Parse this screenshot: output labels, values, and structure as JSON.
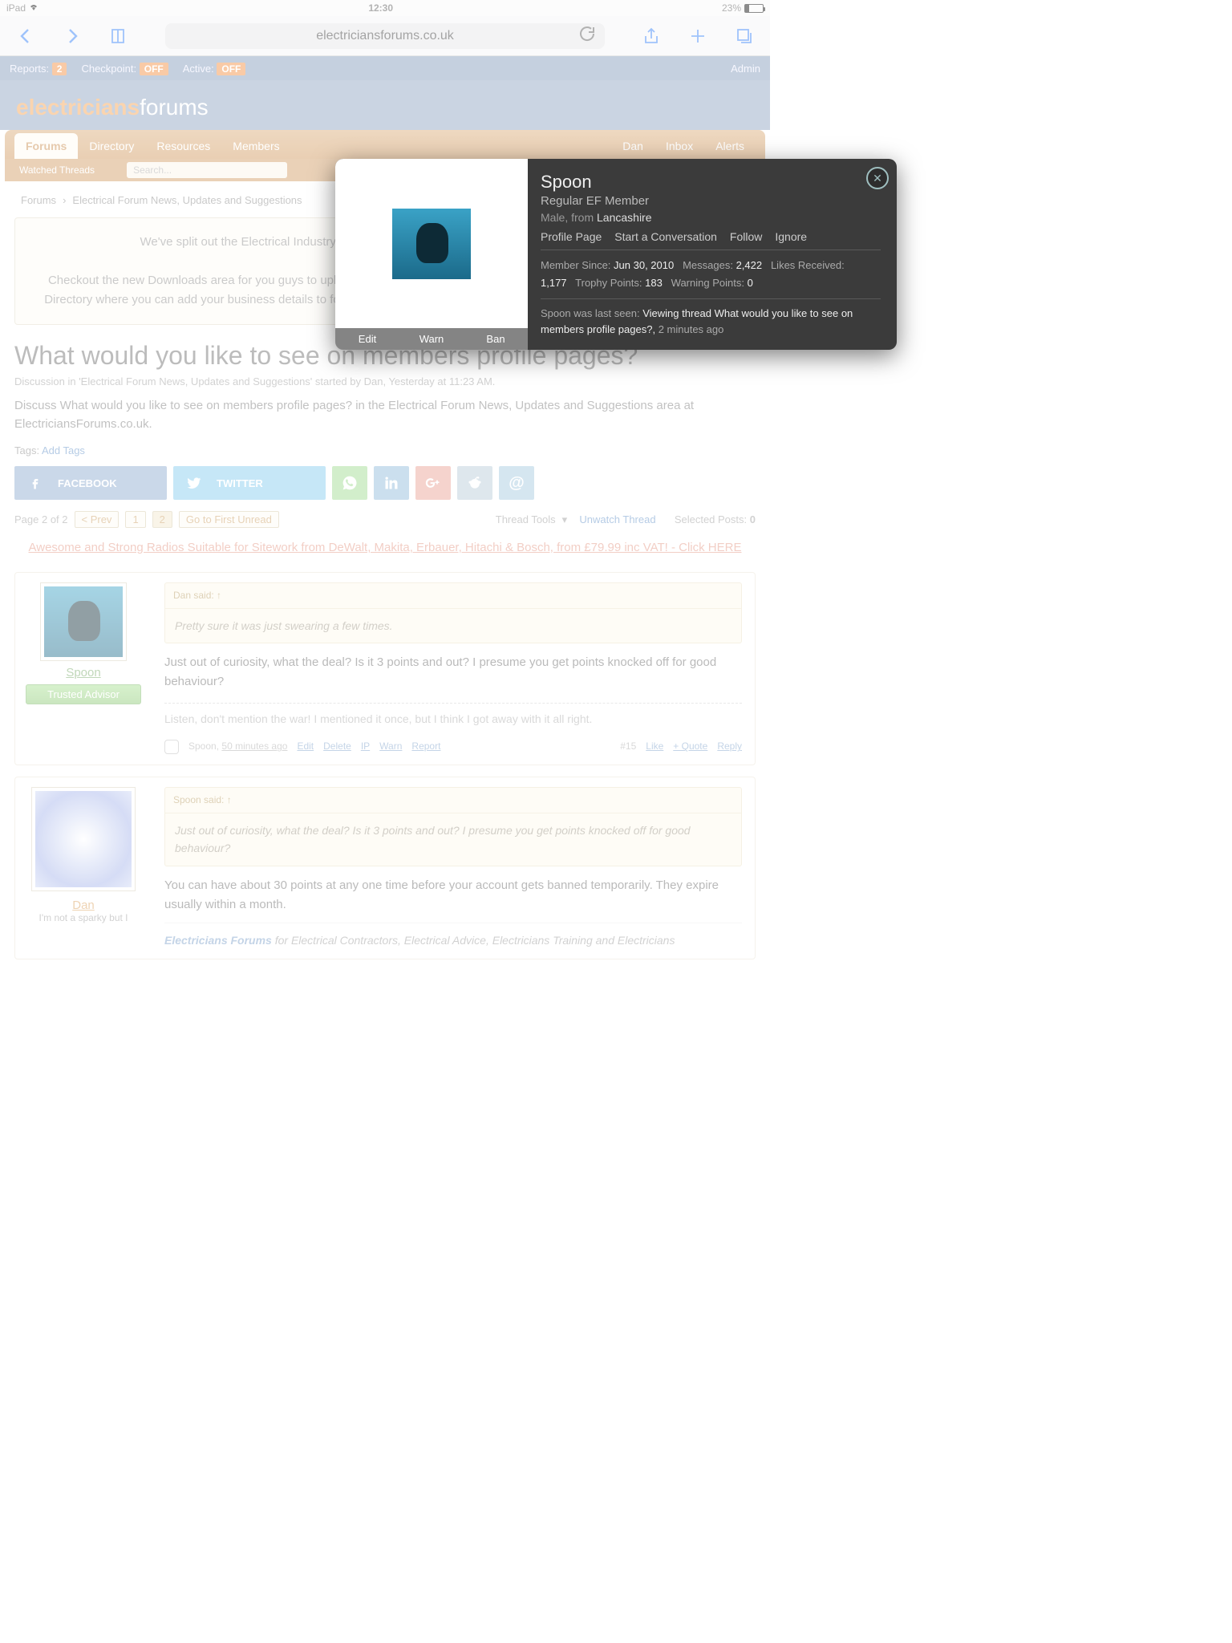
{
  "status": {
    "device": "iPad",
    "time": "12:30",
    "battery": "23%"
  },
  "browser": {
    "url": "electriciansforums.co.uk"
  },
  "adminbar": {
    "reports": "Reports:",
    "reports_n": "2",
    "checkpoint": "Checkpoint:",
    "cp_v": "OFF",
    "active": "Active:",
    "ac_v": "OFF",
    "admin": "Admin"
  },
  "logo": {
    "a": "electricians",
    "b": "forums"
  },
  "nav": {
    "forums": "Forums",
    "directory": "Directory",
    "resources": "Resources",
    "members": "Members",
    "user": "Dan",
    "inbox": "Inbox",
    "alerts": "Alerts"
  },
  "subnav": {
    "watched": "Watched Threads",
    "search_ph": "Search..."
  },
  "crumbs": {
    "a": "Forums",
    "b": "Electrical Forum News, Updates and Suggestions"
  },
  "notice": {
    "l1": "We've split out the Electrical Industry Electrician Talk from the main Electrical Forum. Please",
    "l2": "Checkout the new Downloads area for you guys to upload anything you have that'd be handy for others, and of course the new Directory where you can add your business details to for free. And of course, make sure you know where the Solar PV Forum is."
  },
  "thread": {
    "title": "What would you like to see on members profile pages?",
    "meta": "Discussion in 'Electrical Forum News, Updates and Suggestions' started by Dan, Yesterday at 11:23 AM.",
    "desc": "Discuss What would you like to see on members profile pages? in the Electrical Forum News, Updates and Suggestions area at ElectriciansForums.co.uk.",
    "tags_l": "Tags: ",
    "tags_a": "Add Tags"
  },
  "share": {
    "fb": "FACEBOOK",
    "tw": "TWITTER"
  },
  "pager": {
    "info": "Page 2 of 2",
    "prev": "< Prev",
    "p1": "1",
    "p2": "2",
    "first": "Go to First Unread",
    "tools": "Thread Tools",
    "unwatch": "Unwatch Thread",
    "sel": "Selected Posts:",
    "sel_n": "0"
  },
  "promo": "Awesome and Strong Radios Suitable for Sitework from DeWalt, Makita, Erbauer, Hitachi & Bosch, from £79.99 inc VAT! - Click HERE",
  "post1": {
    "user": "Spoon",
    "badge": "Trusted Advisor",
    "qh": "Dan said: ↑",
    "qb": "Pretty sure it was just swearing a few times.",
    "body": "Just out of curiosity, what the deal? Is it 3 points and out? I presume you get points knocked off for good behaviour?",
    "sig": "Listen, don't mention the war! I mentioned it once, but I think I got away with it all right.",
    "by": "Spoon,",
    "time": "50 minutes ago",
    "edit": "Edit",
    "del": "Delete",
    "ip": "IP",
    "warn": "Warn",
    "rep": "Report",
    "num": "#15",
    "like": "Like",
    "quote": "+ Quote",
    "reply": "Reply"
  },
  "post2": {
    "user": "Dan",
    "role": "I'm not a sparky but I",
    "qh": "Spoon said: ↑",
    "qb": "Just out of curiosity, what the deal? Is it 3 points and out? I presume you get points knocked off for good behaviour?",
    "body": "You can have about 30 points at any one time before your account gets banned temporarily. They expire usually within a month.",
    "foot_b": "Electricians Forums",
    "foot": " for Electrical Contractors, Electrical Advice, Electricians Training and Electricians"
  },
  "modal": {
    "name": "Spoon",
    "role": "Regular EF Member",
    "gender": "Male,",
    "from": " from ",
    "loc": "Lancashire",
    "links": {
      "profile": "Profile Page",
      "conv": "Start a Conversation",
      "follow": "Follow",
      "ignore": "Ignore"
    },
    "stats": {
      "ms_l": "Member Since: ",
      "ms_v": "Jun 30, 2010",
      "msg_l": "Messages: ",
      "msg_v": "2,422",
      "lr_l": "Likes Received:",
      "lr_v": "1,177",
      "tp_l": "Trophy Points: ",
      "tp_v": "183",
      "wp_l": "Warning Points: ",
      "wp_v": "0"
    },
    "last": {
      "a": "Spoon was last seen: ",
      "b": "Viewing thread What would you like to see on members profile pages?,",
      "c": " 2 minutes ago"
    },
    "tools": {
      "edit": "Edit",
      "warn": "Warn",
      "ban": "Ban"
    }
  }
}
